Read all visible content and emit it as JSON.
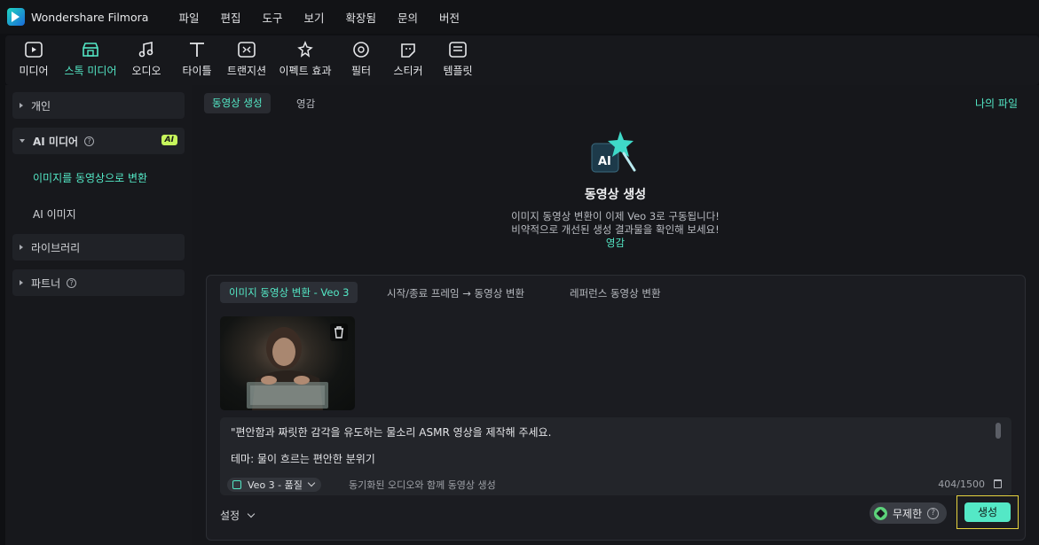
{
  "app": {
    "name": "Wondershare Filmora"
  },
  "menu": [
    "파일",
    "편집",
    "도구",
    "보기",
    "확장됨",
    "문의",
    "버전"
  ],
  "toolbar": [
    {
      "label": "미디어",
      "icon": "media-icon"
    },
    {
      "label": "스톡 미디어",
      "icon": "stock-media-icon",
      "active": true
    },
    {
      "label": "오디오",
      "icon": "audio-icon"
    },
    {
      "label": "타이틀",
      "icon": "title-icon"
    },
    {
      "label": "트랜지션",
      "icon": "transition-icon"
    },
    {
      "label": "이펙트 효과",
      "icon": "effects-icon"
    },
    {
      "label": "필터",
      "icon": "filter-icon"
    },
    {
      "label": "스티커",
      "icon": "sticker-icon"
    },
    {
      "label": "템플릿",
      "icon": "template-icon"
    }
  ],
  "sidebar": {
    "personal": "개인",
    "ai_media": "AI 미디어",
    "ai_badge": "AI",
    "image_to_video": "이미지를 동영상으로 변환",
    "ai_image": "AI 이미지",
    "library": "라이브러리",
    "partner": "파트너"
  },
  "main": {
    "tab_active": "동영상 생성",
    "tab_inspiration": "영감",
    "my_files": "나의 파일",
    "hero_title": "동영상 생성",
    "hero_line1": "이미지 동영상 변환이 이제 Veo 3로 구동됩니다!",
    "hero_line2": "비약적으로 개선된 생성 결과물을 확인해 보세요!",
    "hero_link": "영감"
  },
  "panel": {
    "tabs": [
      "이미지 동영상 변환 - Veo 3",
      "시작/종료 프레임 → 동영상 변환",
      "레퍼런스 동영상 변환"
    ],
    "prompt_line1": "\"편안함과 짜릿한 감각을 유도하는 물소리 ASMR 영상을 제작해 주세요.",
    "prompt_line2": "테마: 물이 흐르는 편안한 분위기",
    "model": "Veo 3 - 품질",
    "audio_label": "동기화된 오디오와 함께 동영상 생성",
    "counter": "404/1500",
    "settings": "설정",
    "unlimited": "무제한",
    "generate": "생성"
  },
  "colors": {
    "accent": "#54e8c6",
    "badge": "#c6f55c",
    "highlight": "#e7d33f"
  }
}
